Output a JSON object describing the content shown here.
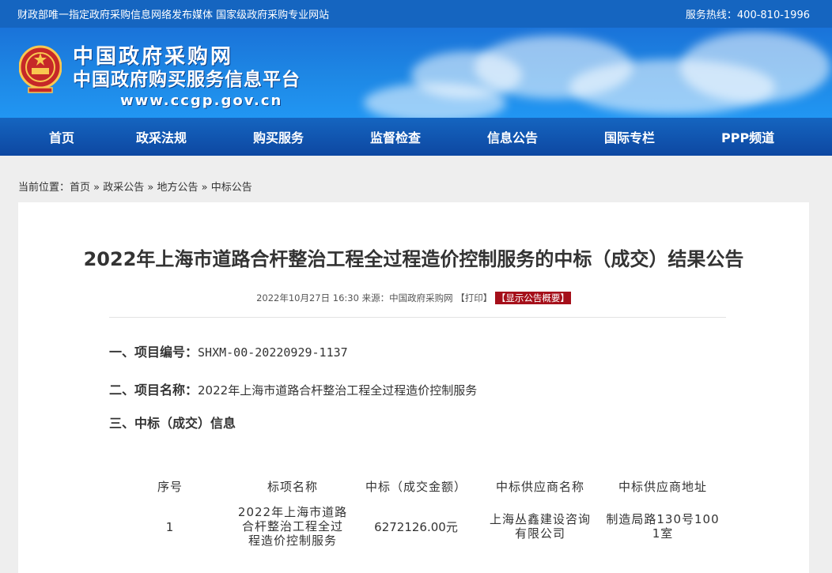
{
  "topbar": {
    "left": "财政部唯一指定政府采购信息网络发布媒体 国家级政府采购专业网站",
    "right": "服务热线：400-810-1996"
  },
  "logo": {
    "line1": "中国政府采购网",
    "line2": "中国政府购买服务信息平台",
    "url": "www.ccgp.gov.cn"
  },
  "nav": [
    {
      "label": "首页"
    },
    {
      "label": "政采法规"
    },
    {
      "label": "购买服务"
    },
    {
      "label": "监督检查"
    },
    {
      "label": "信息公告"
    },
    {
      "label": "国际专栏"
    },
    {
      "label": "PPP频道"
    }
  ],
  "breadcrumb": {
    "prefix": "当前位置：",
    "items": [
      "首页",
      "政采公告",
      "地方公告",
      "中标公告"
    ],
    "sep": " » "
  },
  "article": {
    "title": "2022年上海市道路合杆整治工程全过程造价控制服务的中标（成交）结果公告",
    "meta": "2022年10月27日 16:30 来源：中国政府采购网",
    "print_label": "【打印】",
    "summary_label": "【显示公告概要】",
    "sections": {
      "s1_head": "一、项目编号：",
      "s1_val": "SHXM-00-20220929-1137",
      "s2_head": "二、项目名称：",
      "s2_val": "2022年上海市道路合杆整治工程全过程造价控制服务",
      "s3_head": "三、中标（成交）信息"
    },
    "table": {
      "headers": [
        "序号",
        "标项名称",
        "中标（成交金额）",
        "中标供应商名称",
        "中标供应商地址"
      ],
      "row": {
        "no": "1",
        "name_l1": "2022年上海市道路",
        "name_l2": "合杆整治工程全过",
        "name_l3": "程造价控制服务",
        "amount": "6272126.00元",
        "supplier_l1": "上海丛鑫建设咨询",
        "supplier_l2": "有限公司",
        "address_l1": "制造局路130号100",
        "address_l2": "1室"
      }
    }
  },
  "colors": {
    "topbar": "#1565c0",
    "nav": "#0d47a1",
    "summary_button": "#a50f1a"
  }
}
